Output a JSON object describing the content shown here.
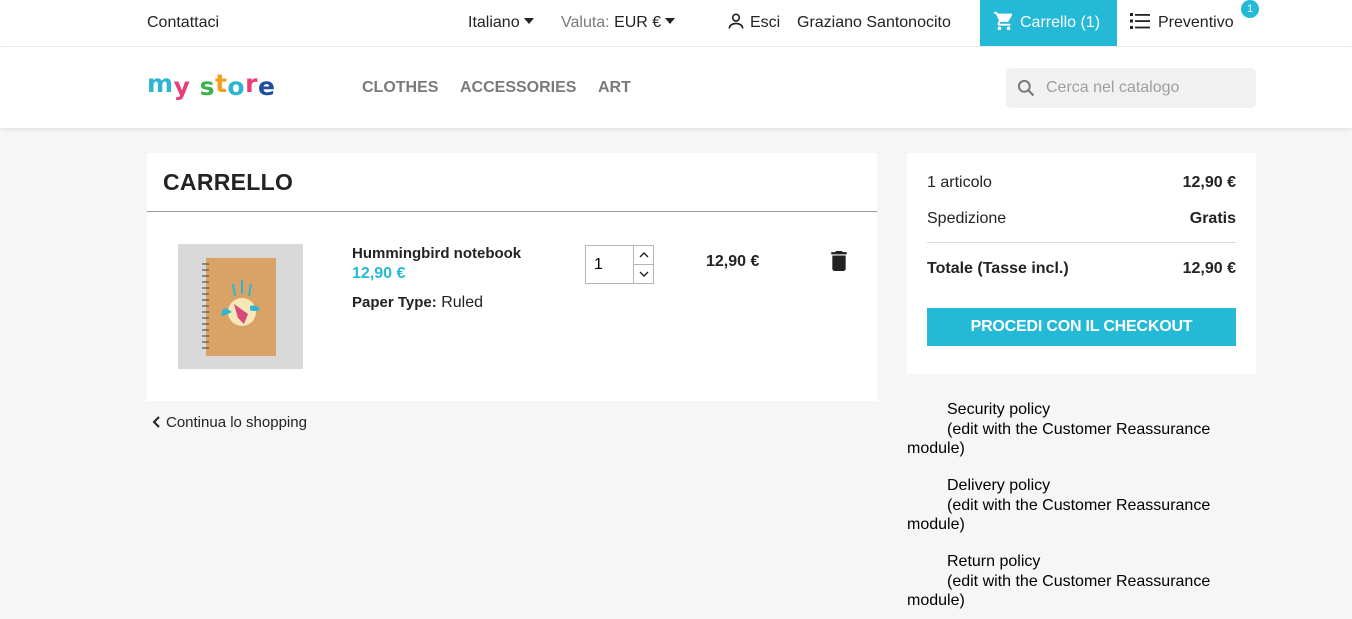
{
  "topbar": {
    "contact": "Contattaci",
    "language": "Italiano",
    "currency_label": "Valuta:",
    "currency_value": "EUR €",
    "logout": "Esci",
    "user_name": "Graziano Santonocito",
    "cart": "Carrello (1)",
    "quote": "Preventivo",
    "quote_badge": "1"
  },
  "header": {
    "logo": [
      "m",
      "y",
      " ",
      "s",
      "t",
      "o",
      "r",
      "e"
    ],
    "logo_colors": [
      "#2fb5d2",
      "#e93e78",
      "#fff",
      "#3ab34a",
      "#f4a01c",
      "#2fb5d2",
      "#e93e78",
      "#1d4fa0"
    ],
    "nav": [
      "CLOTHES",
      "ACCESSORIES",
      "ART"
    ],
    "search_placeholder": "Cerca nel catalogo"
  },
  "cart": {
    "title": "CARRELLO",
    "item": {
      "name": "Hummingbird notebook",
      "price": "12,90 €",
      "attr_label": "Paper Type:",
      "attr_value": "Ruled",
      "quantity": "1",
      "total": "12,90 €"
    },
    "continue": "Continua lo shopping"
  },
  "summary": {
    "items_label": "1 articolo",
    "items_value": "12,90 €",
    "shipping_label": "Spedizione",
    "shipping_value": "Gratis",
    "total_label": "Totale (Tasse incl.)",
    "total_value": "12,90 €",
    "checkout": "PROCEDI CON IL CHECKOUT"
  },
  "reassurance": [
    {
      "title": "Security policy",
      "note": "(edit with the Customer Reassurance",
      "tail": "module)"
    },
    {
      "title": "Delivery policy",
      "note": "(edit with the Customer Reassurance",
      "tail": "module)"
    },
    {
      "title": "Return policy",
      "note": "(edit with the Customer Reassurance",
      "tail": "module)"
    }
  ],
  "colors": {
    "accent": "#24b9d7",
    "background": "#f6f6f6"
  }
}
